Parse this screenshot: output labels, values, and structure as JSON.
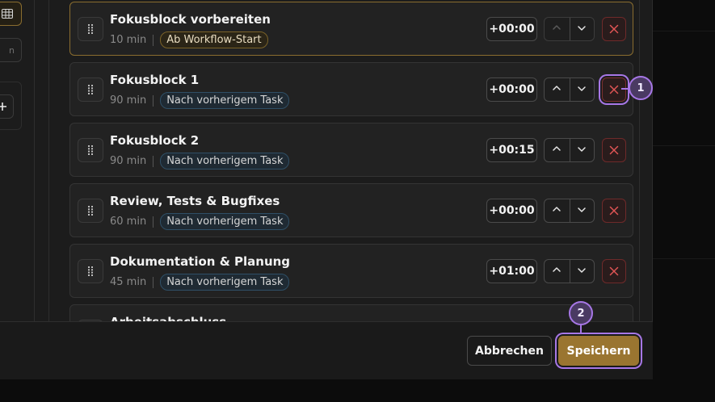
{
  "tasks": [
    {
      "title": "Fokusblock vorbereiten",
      "duration": "10 min",
      "relation": "Ab Workflow-Start",
      "offset": "+00:00"
    },
    {
      "title": "Fokusblock 1",
      "duration": "90 min",
      "relation": "Nach vorherigem Task",
      "offset": "+00:00"
    },
    {
      "title": "Fokusblock 2",
      "duration": "90 min",
      "relation": "Nach vorherigem Task",
      "offset": "+00:15"
    },
    {
      "title": "Review, Tests & Bugfixes",
      "duration": "60 min",
      "relation": "Nach vorherigem Task",
      "offset": "+00:00"
    },
    {
      "title": "Dokumentation & Planung",
      "duration": "45 min",
      "relation": "Nach vorherigem Task",
      "offset": "+01:00"
    },
    {
      "title": "Arbeitsabschluss"
    }
  ],
  "left_rail": {
    "partial_button_text": "n"
  },
  "footer": {
    "cancel_label": "Abbrechen",
    "save_label": "Speichern"
  },
  "markers": [
    "1",
    "2"
  ],
  "icons": {
    "drag": "drag-handle-icon",
    "up": "chevron-up-icon",
    "down": "chevron-down-icon",
    "delete": "close-icon",
    "grid": "grid-icon",
    "plus": "plus-icon"
  },
  "colors": {
    "accent": "#9a7530",
    "focus_ring": "#a777e6",
    "danger": "#d9534f",
    "badge_blue_border": "#2f4f66"
  }
}
